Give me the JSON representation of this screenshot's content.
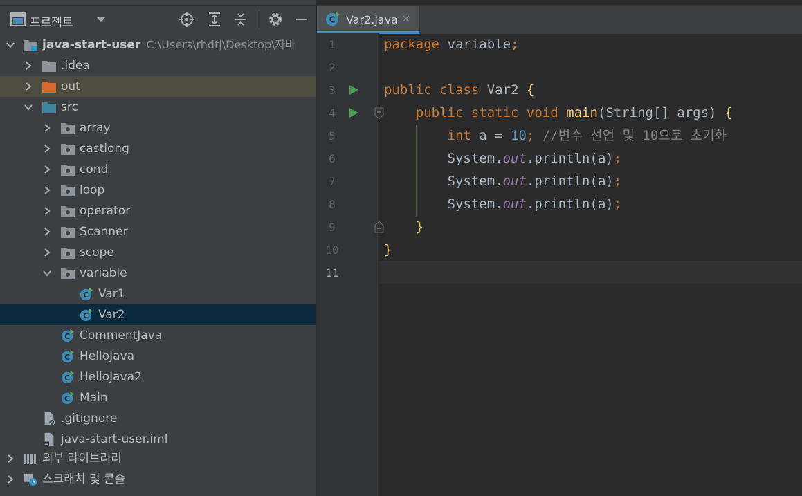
{
  "project_panel": {
    "title": "프로젝트",
    "tree": [
      {
        "label": "java-start-user",
        "path": "C:\\Users\\rhdtj\\Desktop\\자바",
        "type": "module",
        "expanded": true
      },
      {
        "label": ".idea",
        "type": "folder",
        "expanded": false
      },
      {
        "label": "out",
        "type": "folder-excluded",
        "expanded": false
      },
      {
        "label": "src",
        "type": "source-folder",
        "expanded": true
      },
      {
        "label": "array",
        "type": "package",
        "expanded": false
      },
      {
        "label": "castiong",
        "type": "package",
        "expanded": false
      },
      {
        "label": "cond",
        "type": "package",
        "expanded": false
      },
      {
        "label": "loop",
        "type": "package",
        "expanded": false
      },
      {
        "label": "operator",
        "type": "package",
        "expanded": false
      },
      {
        "label": "Scanner",
        "type": "package",
        "expanded": false
      },
      {
        "label": "scope",
        "type": "package",
        "expanded": false
      },
      {
        "label": "variable",
        "type": "package",
        "expanded": true
      },
      {
        "label": "Var1",
        "type": "class"
      },
      {
        "label": "Var2",
        "type": "class",
        "selected": true
      },
      {
        "label": "CommentJava",
        "type": "class"
      },
      {
        "label": "HelloJava",
        "type": "class"
      },
      {
        "label": "HelloJava2",
        "type": "class"
      },
      {
        "label": "Main",
        "type": "class"
      },
      {
        "label": ".gitignore",
        "type": "file"
      },
      {
        "label": "java-start-user.iml",
        "type": "file"
      },
      {
        "label": "외부 라이브러리",
        "type": "libraries"
      },
      {
        "label": "스크래치 및 콘솔",
        "type": "scratches"
      }
    ]
  },
  "editor": {
    "tab_label": "Var2.java",
    "tab_close": "×",
    "line_numbers": [
      "1",
      "2",
      "3",
      "4",
      "5",
      "6",
      "7",
      "8",
      "9",
      "10",
      "11"
    ],
    "current_line": "11",
    "code": {
      "l1_kw": "package",
      "l1_rest": " variable",
      "l1_semi": ";",
      "l3_kw": "public class",
      "l3_name": " Var2 ",
      "l3_brace": "{",
      "l4_kw": "public static void",
      "l4_fn": "main",
      "l4_args": "(String[] args) ",
      "l4_brace": "{",
      "l5_kw": "int",
      "l5_mid": " a = ",
      "l5_num": "10",
      "l5_semi": ";",
      "l5_comment": " //변수 선언 및 10으로 초기화",
      "sys": "System.",
      "out": "out",
      "println": ".println(a)",
      "semi": ";",
      "close_brace": "}"
    }
  },
  "colors": {
    "keyword": "#cc7832",
    "function": "#ffc66d",
    "number": "#6897bb",
    "comment": "#808080",
    "static_field": "#9876aa",
    "selection": "#0d293e",
    "tab_accent": "#4a88c7"
  }
}
